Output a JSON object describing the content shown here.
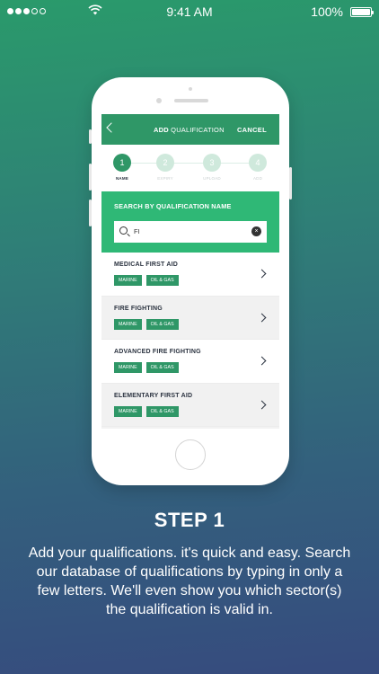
{
  "status_bar": {
    "time": "9:41 AM",
    "battery": "100%",
    "signal_total": 5,
    "signal_filled": 3
  },
  "app": {
    "header": {
      "title_bold": "ADD",
      "title_rest": "QUALIFICATION",
      "cancel_label": "CANCEL"
    },
    "steps": [
      {
        "number": "1",
        "label": "NAME",
        "active": true
      },
      {
        "number": "2",
        "label": "EXPIRY",
        "active": false
      },
      {
        "number": "3",
        "label": "UPLOAD",
        "active": false
      },
      {
        "number": "4",
        "label": "ADD",
        "active": false
      }
    ],
    "search": {
      "label": "SEARCH BY QUALIFICATION NAME",
      "value": "FI",
      "clear_glyph": "×"
    },
    "results": [
      {
        "title": "MEDICAL FIRST AID",
        "tags": [
          "MARINE",
          "OIL & GAS"
        ]
      },
      {
        "title": "FIRE FIGHTING",
        "tags": [
          "MARINE",
          "OIL & GAS"
        ]
      },
      {
        "title": "ADVANCED FIRE FIGHTING",
        "tags": [
          "MARINE",
          "OIL & GAS"
        ]
      },
      {
        "title": "ELEMENTARY FIRST AID",
        "tags": [
          "MARINE",
          "OIL & GAS"
        ]
      }
    ]
  },
  "promo": {
    "heading": "STEP 1",
    "description": "Add your qualifications. it's quick and easy. Search our database of qualifications by typing in only a few letters. We'll even show you which sector(s) the qualification is valid in."
  },
  "colors": {
    "primary_green": "#2f9767",
    "search_panel_green": "#2fb876",
    "text_dark": "#2b3340"
  },
  "icons": [
    "cellular-signal-icon",
    "wifi-icon",
    "battery-icon",
    "back-chevron-icon",
    "search-icon",
    "clear-icon",
    "chevron-right-icon"
  ]
}
